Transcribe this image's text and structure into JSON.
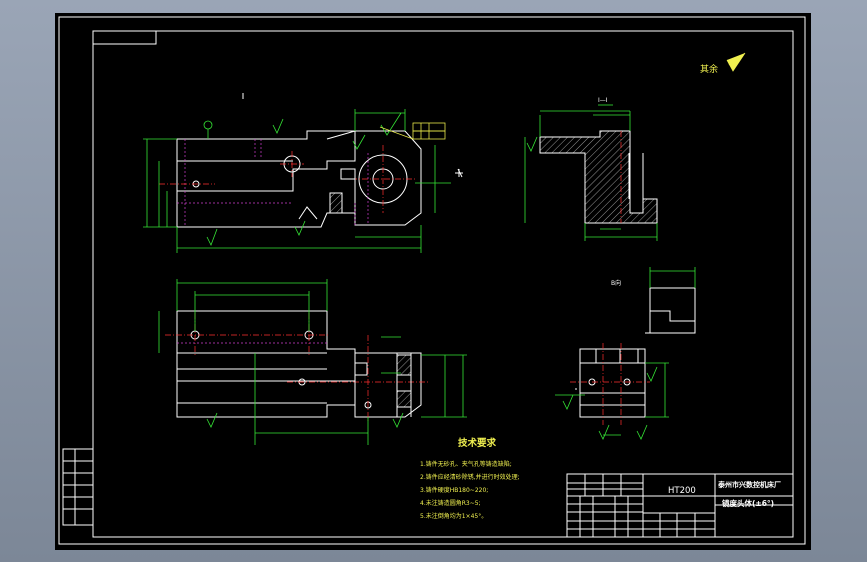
{
  "drawing": {
    "roughness_symbol": "其余",
    "section_label_top": "I—I",
    "section_label_bottom": "B向",
    "tech_req": {
      "title": "技术要求",
      "items": [
        "1.铸件无砂孔、夹气孔等铸造缺陷;",
        "2.铸件应经清砂除锈,并进行时效处理;",
        "3.铸件硬度HB180~220;",
        "4.未注铸造圆角R3~5;",
        "5.未注倒角均为1×45°。"
      ]
    },
    "title_block": {
      "material": "HT200",
      "company": "泰州市兴数控机床厂",
      "part_name": "镜度头体(±6°)"
    }
  },
  "colors": {
    "geometry": "#ffffff",
    "dimension": "#35e635",
    "centerline": "#ff3030",
    "hidden": "#d040d0",
    "annotation": "#f0f050"
  }
}
